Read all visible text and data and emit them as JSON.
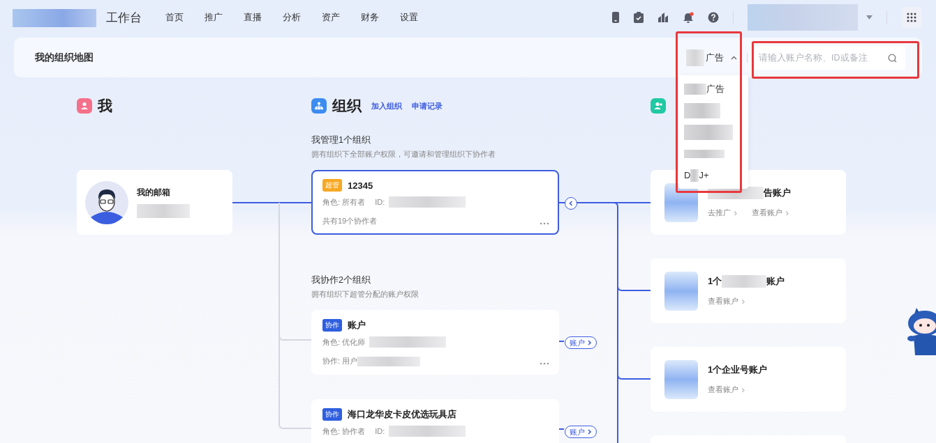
{
  "topbar": {
    "title": "工作台",
    "nav": [
      {
        "label": "首页",
        "selected": false
      },
      {
        "label": "推广",
        "selected": false
      },
      {
        "label": "直播",
        "selected": false
      },
      {
        "label": "分析",
        "selected": false
      },
      {
        "label": "资产",
        "selected": false
      },
      {
        "label": "财务",
        "selected": false
      },
      {
        "label": "设置",
        "selected": false
      }
    ],
    "notification_dot": true
  },
  "panel": {
    "title": "我的组织地图",
    "filter": {
      "label": "广告",
      "expanded": true
    },
    "search": {
      "placeholder": "请输入账户名称、ID或备注"
    }
  },
  "dropdown": {
    "items": [
      {
        "segments": [
          {
            "kind": "blur"
          },
          {
            "kind": "text",
            "text": "广告"
          }
        ]
      },
      {
        "segments": [
          {
            "kind": "blur"
          }
        ]
      },
      {
        "segments": [
          {
            "kind": "blur"
          }
        ]
      },
      {
        "segments": [
          {
            "kind": "blur"
          }
        ]
      },
      {
        "segments": [
          {
            "kind": "text",
            "text": "D"
          },
          {
            "kind": "blur"
          },
          {
            "kind": "text",
            "text": "J+"
          }
        ]
      }
    ]
  },
  "me": {
    "heading": "我",
    "card": {
      "title": "我的邮箱"
    }
  },
  "org": {
    "heading": "组织",
    "links": [
      "加入组织",
      "申请记录"
    ],
    "sections": [
      {
        "title": "我管理1个组织",
        "desc": "拥有组织下全部账户权限，可邀请和管理组织下协作者",
        "cards": [
          {
            "badge": "超管",
            "color": "#f7a823",
            "name": "12345",
            "selected": true,
            "role": "角色: 所有者",
            "id_label": "ID:",
            "extra": "共有19个协作者",
            "more": true,
            "collapsible": true
          }
        ]
      },
      {
        "title": "我协作2个组织",
        "desc": "拥有组织下超管分配的账户权限",
        "cards": [
          {
            "badge": "协作",
            "color": "#2f5fe0",
            "name": "账户",
            "selected": false,
            "role": "角色: 优化师",
            "extra": "协作: 用户",
            "more": true,
            "pill": "账户"
          },
          {
            "badge": "协作",
            "color": "#2f5fe0",
            "name": "海口龙华皮卡皮优选玩具店",
            "selected": false,
            "role": "角色: 协作者",
            "id_label": "ID:",
            "more": false,
            "pill": "账户"
          }
        ]
      }
    ]
  },
  "accounts": {
    "cards": [
      {
        "title": [
          {
            "kind": "blur"
          },
          {
            "kind": "text",
            "text": "告账户"
          }
        ],
        "links": [
          "去推广",
          "查看账户"
        ]
      },
      {
        "title": [
          {
            "kind": "text",
            "text": "1个"
          },
          {
            "kind": "blur"
          },
          {
            "kind": "text",
            "text": "账户"
          }
        ],
        "links": [
          "查看账户"
        ]
      },
      {
        "title": [
          {
            "kind": "text",
            "text": "1个企业号账户"
          }
        ],
        "links": [
          "查看账户"
        ]
      }
    ],
    "more_card": true
  }
}
